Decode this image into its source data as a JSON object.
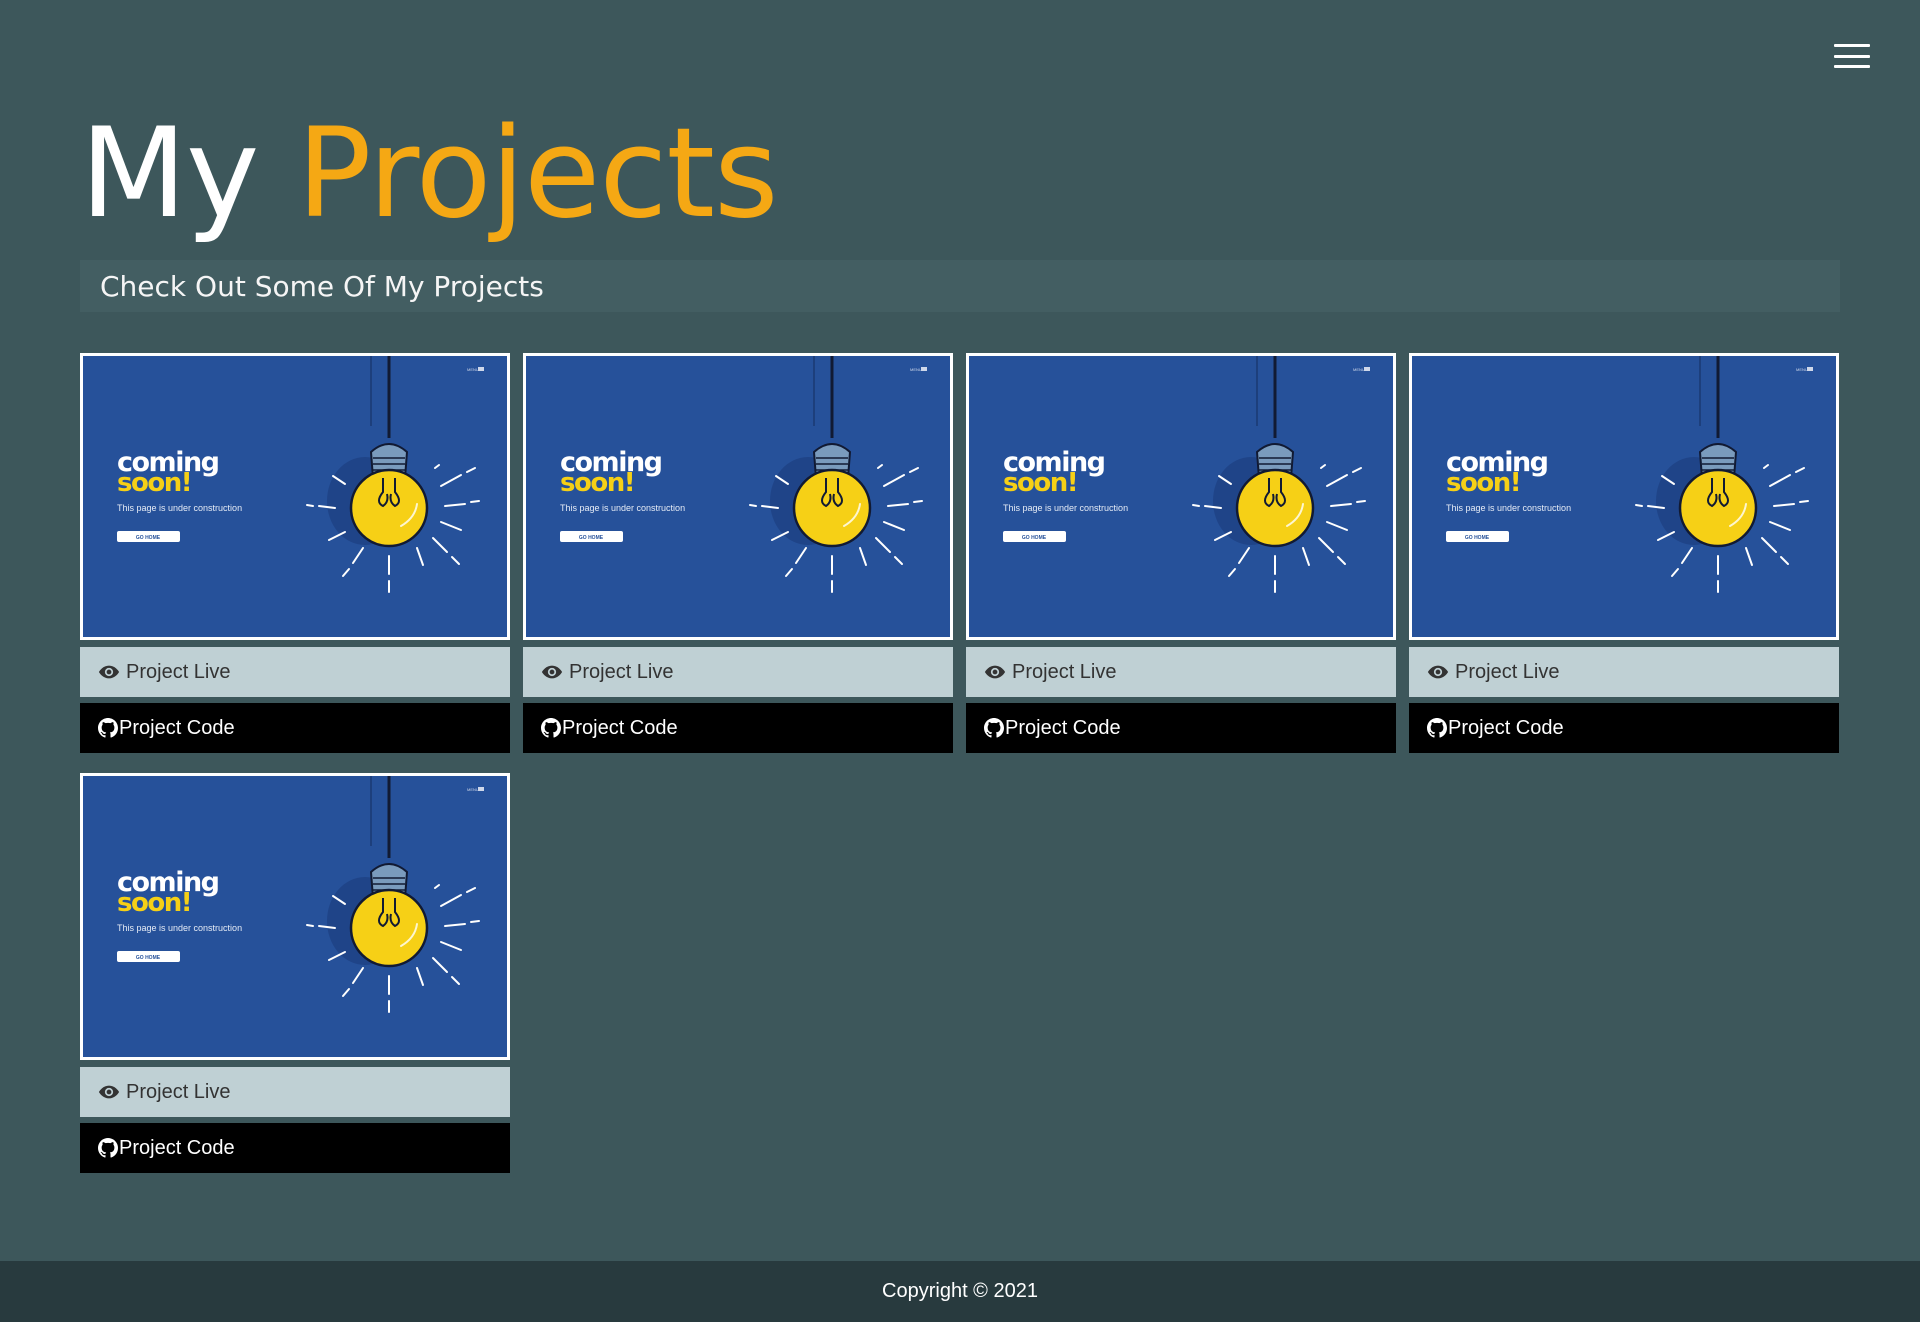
{
  "nav": {
    "menu_icon": "hamburger-menu-icon"
  },
  "header": {
    "title_prefix": "My",
    "title_accent": "Projects",
    "subtitle": "Check Out Some Of My Projects"
  },
  "colors": {
    "background": "#3d575b",
    "accent": "#f5a814",
    "live_button_bg": "#bfd0d4",
    "code_button_bg": "#000000",
    "footer_bg": "#283a3e",
    "thumbnail_bg": "#26519a"
  },
  "projects": [
    {
      "thumbnail": {
        "headline_line1": "coming",
        "headline_line2": "soon!",
        "tagline": "This page is under construction",
        "button": "GO HOME",
        "menu": "MENU"
      },
      "live_label": "Project Live",
      "live_icon": "eye-icon",
      "code_label": "Project Code",
      "code_icon": "github-icon"
    },
    {
      "thumbnail": {
        "headline_line1": "coming",
        "headline_line2": "soon!",
        "tagline": "This page is under construction",
        "button": "GO HOME",
        "menu": "MENU"
      },
      "live_label": "Project Live",
      "live_icon": "eye-icon",
      "code_label": "Project Code",
      "code_icon": "github-icon"
    },
    {
      "thumbnail": {
        "headline_line1": "coming",
        "headline_line2": "soon!",
        "tagline": "This page is under construction",
        "button": "GO HOME",
        "menu": "MENU"
      },
      "live_label": "Project Live",
      "live_icon": "eye-icon",
      "code_label": "Project Code",
      "code_icon": "github-icon"
    },
    {
      "thumbnail": {
        "headline_line1": "coming",
        "headline_line2": "soon!",
        "tagline": "This page is under construction",
        "button": "GO HOME",
        "menu": "MENU"
      },
      "live_label": "Project Live",
      "live_icon": "eye-icon",
      "code_label": "Project Code",
      "code_icon": "github-icon"
    },
    {
      "thumbnail": {
        "headline_line1": "coming",
        "headline_line2": "soon!",
        "tagline": "This page is under construction",
        "button": "GO HOME",
        "menu": "MENU"
      },
      "live_label": "Project Live",
      "live_icon": "eye-icon",
      "code_label": "Project Code",
      "code_icon": "github-icon"
    }
  ],
  "footer": {
    "copyright": "Copyright © 2021"
  }
}
